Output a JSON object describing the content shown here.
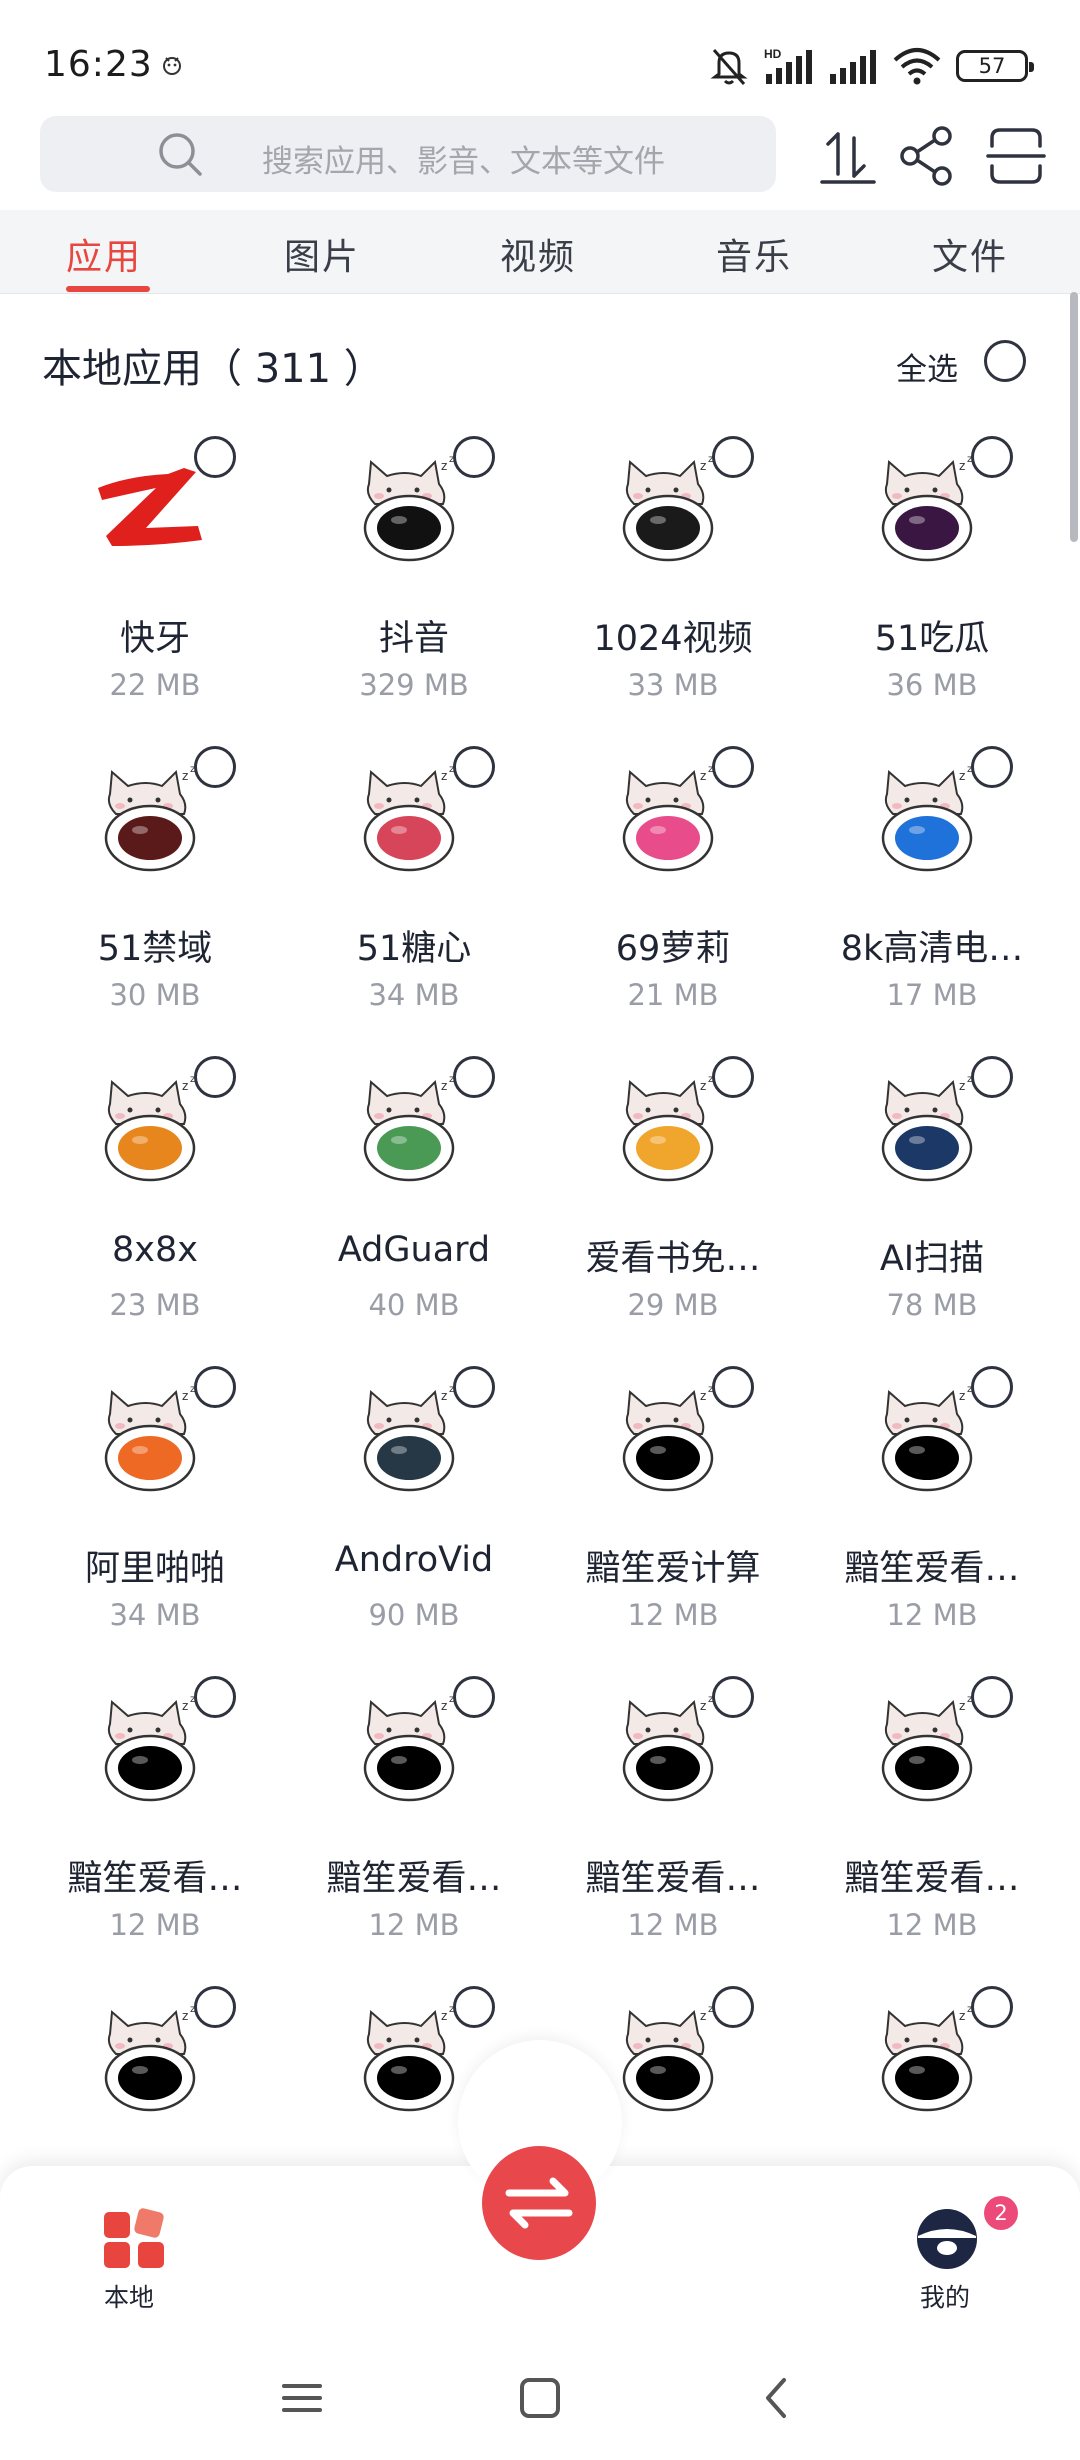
{
  "status_bar": {
    "time": "16:23",
    "battery": "57",
    "icons": [
      "notification-icon",
      "mute-bell-icon",
      "signal-hd-icon",
      "signal-icon",
      "wifi-icon",
      "battery-icon"
    ]
  },
  "search": {
    "placeholder": "搜索应用、影音、文本等文件"
  },
  "top_actions": [
    "sort-icon",
    "share-icon",
    "scan-icon"
  ],
  "tabs": [
    {
      "label": "应用",
      "active": true
    },
    {
      "label": "图片",
      "active": false
    },
    {
      "label": "视频",
      "active": false
    },
    {
      "label": "音乐",
      "active": false
    },
    {
      "label": "文件",
      "active": false
    }
  ],
  "section": {
    "title": "本地应用（ 311 ）",
    "select_all": "全选"
  },
  "apps": [
    {
      "name": "快牙",
      "size": "22 MB",
      "icon": "kuaiya-logo-icon",
      "color": "#e0201c"
    },
    {
      "name": "抖音",
      "size": "329 MB",
      "icon": "douyin-icon",
      "color": "#111111"
    },
    {
      "name": "1024视频",
      "size": "33 MB",
      "icon": "video-app-icon",
      "color": "#1a1a1a"
    },
    {
      "name": "51吃瓜",
      "size": "36 MB",
      "icon": "chigua-icon",
      "color": "#3a1742"
    },
    {
      "name": "51禁域",
      "size": "30 MB",
      "icon": "jinyu-icon",
      "color": "#5a1a1a"
    },
    {
      "name": "51糖心",
      "size": "34 MB",
      "icon": "tangxin-icon",
      "color": "#d6455a"
    },
    {
      "name": "69萝莉",
      "size": "21 MB",
      "icon": "luoli-icon",
      "color": "#e84c8a"
    },
    {
      "name": "8k高清电…",
      "size": "17 MB",
      "icon": "live-icon",
      "color": "#1f72d9"
    },
    {
      "name": "8x8x",
      "size": "23 MB",
      "icon": "8x8x-icon",
      "color": "#e8861e"
    },
    {
      "name": "AdGuard",
      "size": "40 MB",
      "icon": "adguard-icon",
      "color": "#4a9a56"
    },
    {
      "name": "爱看书免…",
      "size": "29 MB",
      "icon": "book-icon",
      "color": "#f0a52c"
    },
    {
      "name": "AI扫描",
      "size": "78 MB",
      "icon": "scan-app-icon",
      "color": "#1c3866"
    },
    {
      "name": "阿里啪啪",
      "size": "34 MB",
      "icon": "alipapa-icon",
      "color": "#ee6a24"
    },
    {
      "name": "AndroVid",
      "size": "90 MB",
      "icon": "androvid-icon",
      "color": "#263845"
    },
    {
      "name": "黯笙爱计算",
      "size": "12 MB",
      "icon": "calculator-app-icon",
      "color": "#000000"
    },
    {
      "name": "黯笙爱看…",
      "size": "12 MB",
      "icon": "app-icon",
      "color": "#000000"
    },
    {
      "name": "黯笙爱看…",
      "size": "12 MB",
      "icon": "app-icon",
      "color": "#000000"
    },
    {
      "name": "黯笙爱看…",
      "size": "12 MB",
      "icon": "app-icon",
      "color": "#000000"
    },
    {
      "name": "黯笙爱看…",
      "size": "12 MB",
      "icon": "app-icon",
      "color": "#000000"
    },
    {
      "name": "黯笙爱看…",
      "size": "12 MB",
      "icon": "app-icon",
      "color": "#000000"
    },
    {
      "name": "",
      "size": "",
      "icon": "app-icon",
      "color": "#000000"
    },
    {
      "name": "",
      "size": "",
      "icon": "app-icon",
      "color": "#000000"
    },
    {
      "name": "",
      "size": "",
      "icon": "app-icon",
      "color": "#000000"
    },
    {
      "name": "",
      "size": "",
      "icon": "app-icon",
      "color": "#000000"
    }
  ],
  "bottom_nav": {
    "local_label": "本地",
    "mine_label": "我的",
    "badge": "2",
    "fab_icon": "transfer-icon"
  },
  "colors": {
    "accent": "#e8473f",
    "fab": "#e8474b",
    "badge": "#ec4a78"
  }
}
